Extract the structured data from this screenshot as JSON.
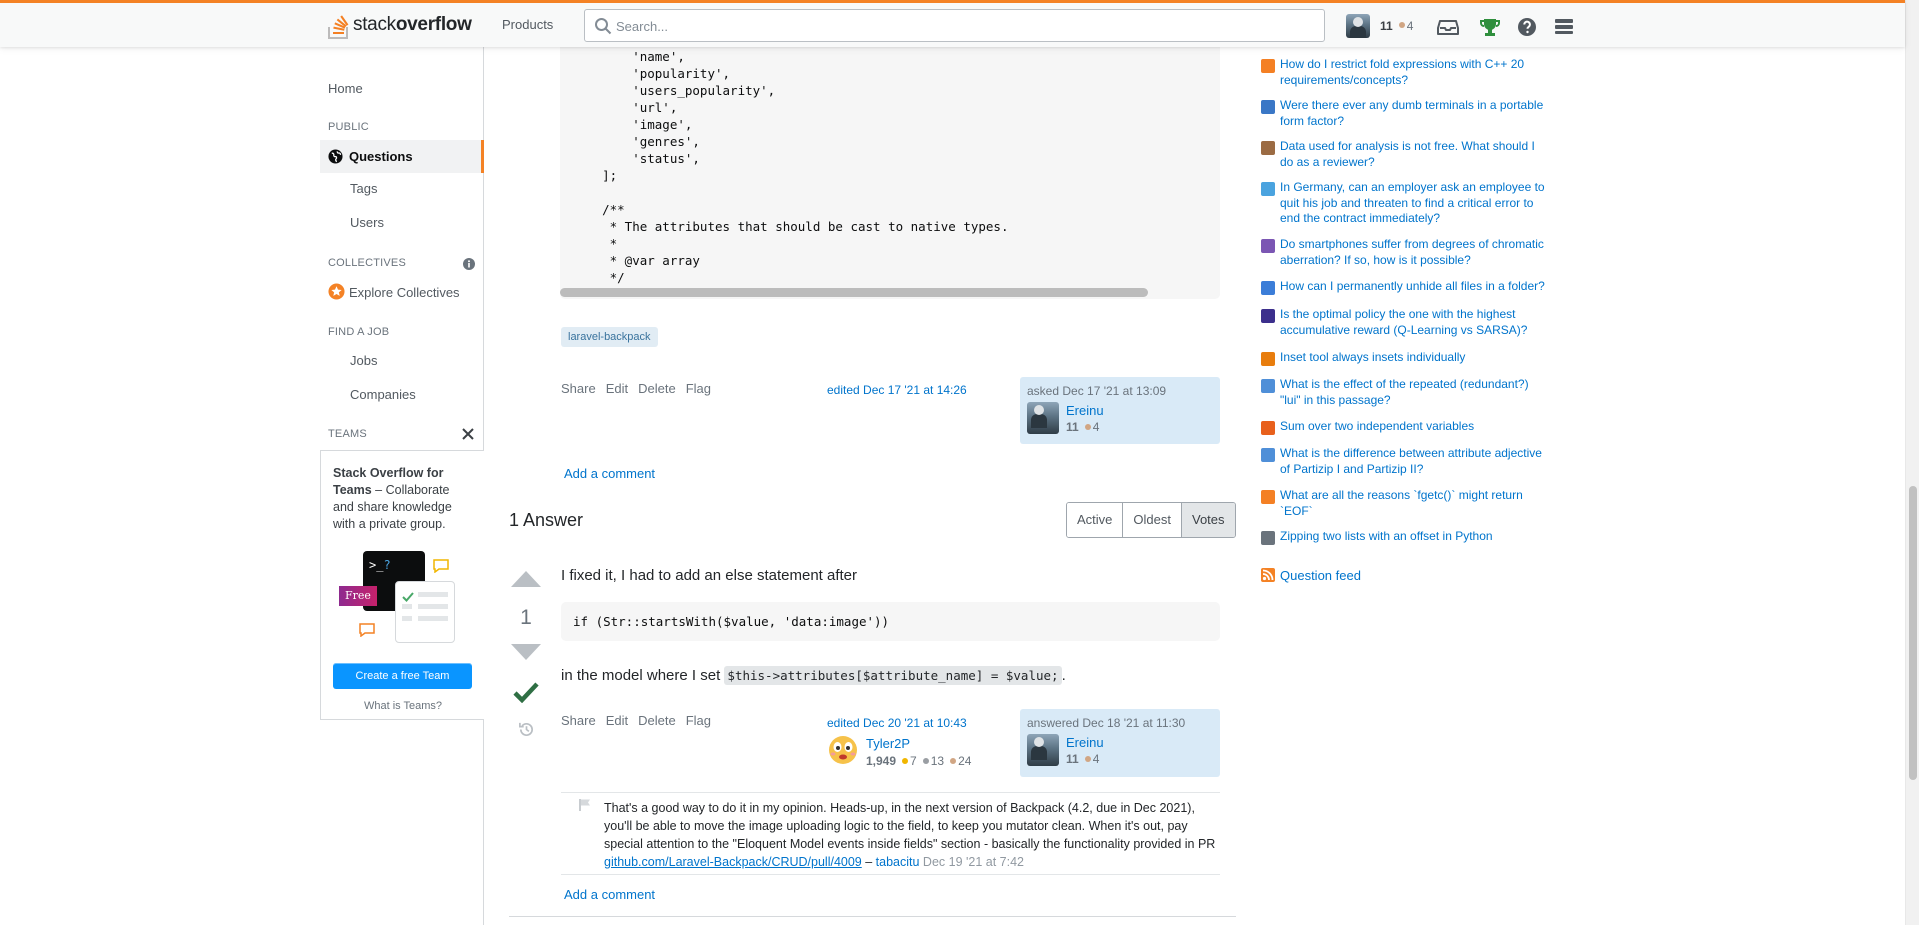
{
  "header": {
    "logo_word1": "stack",
    "logo_word2": "overflow",
    "products_label": "Products",
    "search_placeholder": "Search...",
    "reputation": "11",
    "bronze_count": "4"
  },
  "leftnav": {
    "home": "Home",
    "public_heading": "PUBLIC",
    "questions": "Questions",
    "tags": "Tags",
    "users": "Users",
    "collectives_heading": "COLLECTIVES",
    "explore_collectives": "Explore Collectives",
    "find_job_heading": "FIND A JOB",
    "jobs": "Jobs",
    "companies": "Companies",
    "teams_heading": "TEAMS",
    "teams_title": "Stack Overflow for Teams",
    "teams_desc": " – Collaborate and share knowledge with a private group.",
    "teams_free_badge": "Free",
    "create_team_button": "Create a free Team",
    "what_is_teams": "What is Teams?"
  },
  "question": {
    "code_lines": [
      "        'name',",
      "        'popularity',",
      "        'users_popularity',",
      "        'url',",
      "        'image',",
      "        'genres',",
      "        'status',",
      "    ];",
      "",
      "    /**",
      "     * The attributes that should be cast to native types.",
      "     *",
      "     * @var array",
      "     */"
    ],
    "tag": "laravel-backpack",
    "menu": {
      "share": "Share",
      "edit": "Edit",
      "delete": "Delete",
      "flag": "Flag"
    },
    "edited": "edited Dec 17 '21 at 14:26",
    "asked_time": "asked Dec 17 '21 at 13:09",
    "asker_name": "Ereinu",
    "asker_rep": "11",
    "asker_bronze": "4",
    "add_comment": "Add a comment"
  },
  "answers": {
    "count_label": "1 Answer",
    "sort": {
      "active": "Active",
      "oldest": "Oldest",
      "votes": "Votes"
    }
  },
  "answer": {
    "vote_count": "1",
    "text_1": "I fixed it, I had to add an else statement after",
    "code": "if (Str::startsWith($value, 'data:image'))",
    "text_2_before": "in the model where I set ",
    "text_2_code": "$this->attributes[$attribute_name] = $value;",
    "text_2_after": ".",
    "menu": {
      "share": "Share",
      "edit": "Edit",
      "delete": "Delete",
      "flag": "Flag"
    },
    "edited": "edited Dec 20 '21 at 10:43",
    "editor_name": "Tyler2P",
    "editor_rep": "1,949",
    "editor_gold": "7",
    "editor_silver": "13",
    "editor_bronze": "24",
    "answered_time": "answered Dec 18 '21 at 11:30",
    "answerer_name": "Ereinu",
    "answerer_rep": "11",
    "answerer_bronze": "4",
    "comment_text": "That's a good way to do it in my opinion. Heads-up, in the next version of Backpack (4.2, due in Dec 2021), you'll be able to move the image uploading logic to the field, to keep you mutator clean. When it's out, pay special attention to the \"Eloquent Model events inside fields\" section - basically the functionality provided in PR ",
    "comment_link": "github.com/Laravel-Backpack/CRUD/pull/4009",
    "comment_dash": " – ",
    "comment_user": "tabacitu",
    "comment_date": " Dec 19 '21 at 7:42",
    "add_comment": "Add a comment"
  },
  "sidebar": {
    "hot_questions": [
      {
        "text": "How do I restrict fold expressions with C++ 20 requirements/concepts?",
        "icon_color": "#f48024"
      },
      {
        "text": "Were there ever any dumb terminals in a portable form factor?",
        "icon_color": "#3a77c6"
      },
      {
        "text": "Data used for analysis is not free. What should I do as a reviewer?",
        "icon_color": "#9b6b43"
      },
      {
        "text": "In Germany, can an employer ask an employee to quit his job and threaten to find a critical error to end the contract immediately?",
        "icon_color": "#4aa3df"
      },
      {
        "text": "Do smartphones suffer from degrees of chromatic aberration? If so, how is it possible?",
        "icon_color": "#7b56b3"
      },
      {
        "text": "How can I permanently unhide all files in a folder?",
        "icon_color": "#3b7dd8"
      },
      {
        "text": "Is the optimal policy the one with the highest accumulative reward (Q-Learning vs SARSA)?",
        "icon_color": "#3c2f8c"
      },
      {
        "text": "Inset tool always insets individually",
        "icon_color": "#e87d0d"
      },
      {
        "text": "What is the effect of the repeated (redundant?) \"lui\" in this passage?",
        "icon_color": "#4f8fd8"
      },
      {
        "text": "Sum over two independent variables",
        "icon_color": "#e8601c"
      },
      {
        "text": "What is the difference between attribute adjective of Partizip I and Partizip II?",
        "icon_color": "#4f8fd8"
      },
      {
        "text": "What are all the reasons `fgetc()` might return `EOF`",
        "icon_color": "#f48024"
      },
      {
        "text": "Zipping two lists with an offset in Python",
        "icon_color": "#6a737c"
      }
    ],
    "question_feed": "Question feed"
  },
  "colors": {
    "accent_orange": "#f48225",
    "link_blue": "#0074cc",
    "accepted_green": "#2f6f44",
    "user_card_bg": "#d9eaf7",
    "gold": "#f1b600",
    "silver": "#9a9ea3",
    "bronze": "#d1a684"
  }
}
